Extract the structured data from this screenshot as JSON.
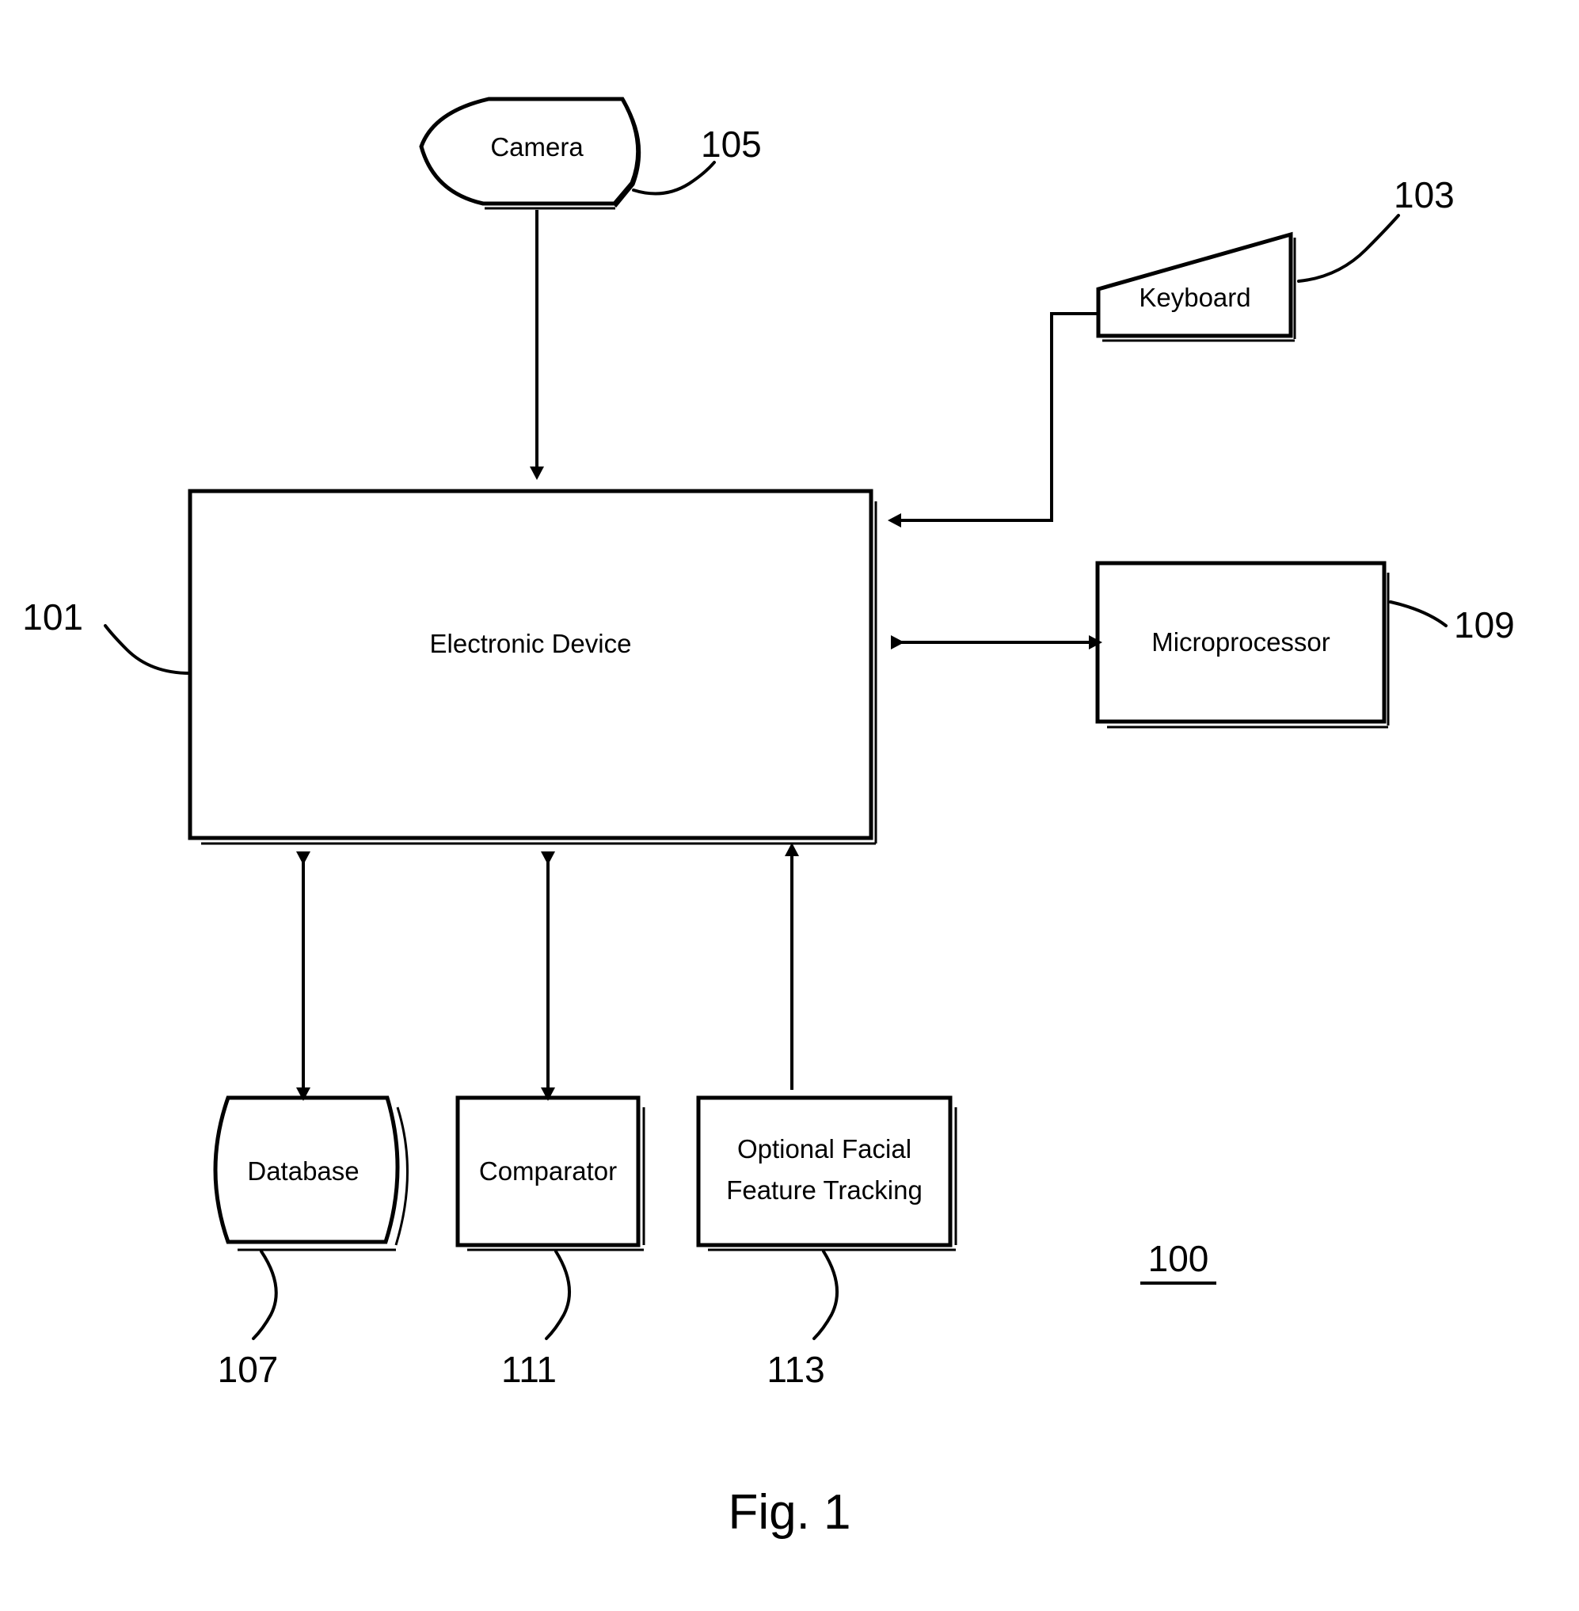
{
  "figure": {
    "caption": "Fig. 1",
    "system_number": "100"
  },
  "nodes": {
    "electronic_device": {
      "label": "Electronic Device",
      "ref": "101",
      "shape": "rectangle"
    },
    "keyboard": {
      "label": "Keyboard",
      "ref": "103",
      "shape": "trapezoid"
    },
    "camera": {
      "label": "Camera",
      "ref": "105",
      "shape": "lens"
    },
    "database": {
      "label": "Database",
      "ref": "107",
      "shape": "drum"
    },
    "microprocessor": {
      "label": "Microprocessor",
      "ref": "109",
      "shape": "rectangle"
    },
    "comparator": {
      "label": "Comparator",
      "ref": "111",
      "shape": "rectangle"
    },
    "facial_tracking": {
      "label_line1": "Optional Facial",
      "label_line2": "Feature Tracking",
      "ref": "113",
      "shape": "rectangle"
    }
  },
  "connections": [
    {
      "from": "camera",
      "to": "electronic_device",
      "direction": "one-way"
    },
    {
      "from": "keyboard",
      "to": "electronic_device",
      "direction": "one-way"
    },
    {
      "from": "electronic_device",
      "to": "microprocessor",
      "direction": "two-way"
    },
    {
      "from": "electronic_device",
      "to": "database",
      "direction": "two-way"
    },
    {
      "from": "electronic_device",
      "to": "comparator",
      "direction": "two-way"
    },
    {
      "from": "facial_tracking",
      "to": "electronic_device",
      "direction": "one-way"
    }
  ],
  "colors": {
    "line": "#000000",
    "fill": "#ffffff",
    "background": "#ffffff"
  }
}
